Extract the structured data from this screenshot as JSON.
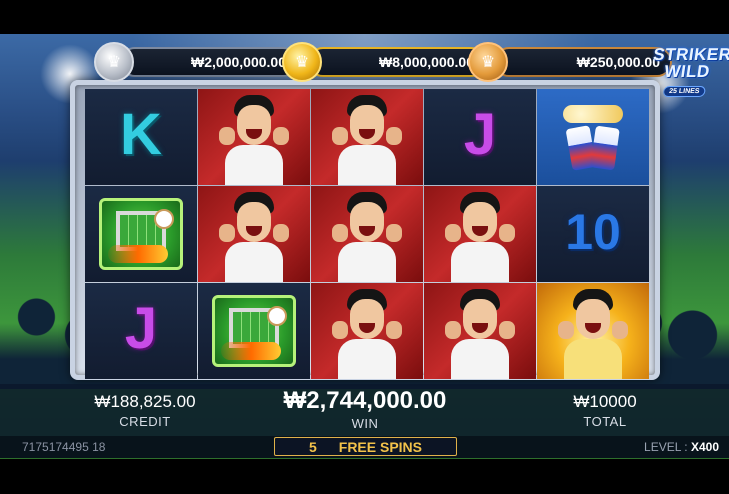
{
  "game": {
    "logo_line1": "STRIKER",
    "logo_line2": "WILD",
    "logo_lines": "25 LINES"
  },
  "jackpots": [
    {
      "tier": "silver",
      "value": "₩2,000,000.00"
    },
    {
      "tier": "gold",
      "value": "₩8,000,000.00"
    },
    {
      "tier": "bronze",
      "value": "₩250,000.00"
    }
  ],
  "reels": [
    [
      "letter-K",
      "goal-wild",
      "letter-J"
    ],
    [
      "player",
      "player",
      "goal-wild"
    ],
    [
      "player",
      "player",
      "player"
    ],
    [
      "letter-J",
      "player",
      "player"
    ],
    [
      "beer-cans",
      "number-10",
      "player-gold"
    ]
  ],
  "reel_text": {
    "k": "K",
    "j": "J",
    "ten": "10"
  },
  "hud": {
    "credit_value": "₩188,825.00",
    "credit_label": "CREDIT",
    "win_value": "₩2,744,000.00",
    "win_label": "WIN",
    "total_value": "₩10000",
    "total_label": "TOTAL"
  },
  "footer": {
    "session_id": "7175174495 18",
    "free_spins_count": "5",
    "free_spins_label": "FREE SPINS",
    "level_label": "LEVEL :",
    "level_value": "X400"
  },
  "colors": {
    "accent_gold": "#f2c24a",
    "frame": "#c9d3e3"
  }
}
